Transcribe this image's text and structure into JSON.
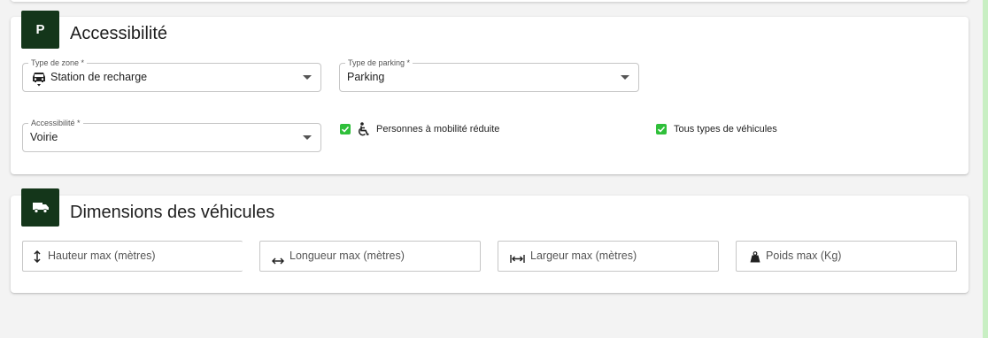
{
  "accessibility_card": {
    "icon_letter": "P",
    "title": "Accessibilité",
    "zone_type": {
      "label": "Type de zone *",
      "value": "Station de recharge",
      "icon": "ev-station-car-icon"
    },
    "parking_type": {
      "label": "Type de parking *",
      "value": "Parking"
    },
    "accessibility": {
      "label": "Accessibilité *",
      "value": "Voirie"
    },
    "checkboxes": [
      {
        "label": "Personnes à mobilité réduite",
        "checked": true,
        "icon": "wheelchair-icon"
      },
      {
        "label": "Tous types de véhicules",
        "checked": true
      }
    ]
  },
  "dimensions_card": {
    "icon": "truck-icon",
    "title": "Dimensions des véhicules",
    "fields": [
      {
        "placeholder": "Hauteur max (mètres)",
        "icon": "height-arrows-icon"
      },
      {
        "placeholder": "Longueur max (mètres)",
        "icon": "length-arrows-icon"
      },
      {
        "placeholder": "Largeur max (mètres)",
        "icon": "width-arrows-icon"
      },
      {
        "placeholder": "Poids max (Kg)",
        "icon": "weight-icon"
      }
    ]
  },
  "colors": {
    "icon_bg": "#14361a",
    "checkbox": "#2fbf3a",
    "scrollbar": "#c8efc3"
  }
}
